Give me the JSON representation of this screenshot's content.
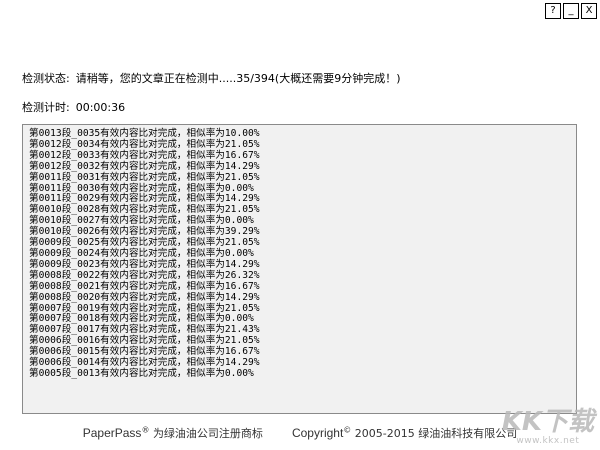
{
  "window": {
    "buttons": [
      {
        "label": "?"
      },
      {
        "label": "_"
      },
      {
        "label": "X"
      }
    ]
  },
  "status": {
    "label": "检测状态:",
    "message": "请稍等，您的文章正在检测中.....35/394(大概还需要9分钟完成！)"
  },
  "timer": {
    "label": "检测计时:",
    "value": "00:00:36"
  },
  "log": {
    "lines": [
      "第0013段_0035有效内容比对完成，相似率为10.00%",
      "第0012段_0034有效内容比对完成，相似率为21.05%",
      "第0012段_0033有效内容比对完成，相似率为16.67%",
      "第0012段_0032有效内容比对完成，相似率为14.29%",
      "第0011段_0031有效内容比对完成，相似率为21.05%",
      "第0011段_0030有效内容比对完成，相似率为0.00%",
      "第0011段_0029有效内容比对完成，相似率为14.29%",
      "第0010段_0028有效内容比对完成，相似率为21.05%",
      "第0010段_0027有效内容比对完成，相似率为0.00%",
      "第0010段_0026有效内容比对完成，相似率为39.29%",
      "第0009段_0025有效内容比对完成，相似率为21.05%",
      "第0009段_0024有效内容比对完成，相似率为0.00%",
      "第0009段_0023有效内容比对完成，相似率为14.29%",
      "第0008段_0022有效内容比对完成，相似率为26.32%",
      "第0008段_0021有效内容比对完成，相似率为16.67%",
      "第0008段_0020有效内容比对完成，相似率为14.29%",
      "第0007段_0019有效内容比对完成，相似率为21.05%",
      "第0007段_0018有效内容比对完成，相似率为0.00%",
      "第0007段_0017有效内容比对完成，相似率为21.43%",
      "第0006段_0016有效内容比对完成，相似率为21.05%",
      "第0006段_0015有效内容比对完成，相似率为16.67%",
      "第0006段_0014有效内容比对完成，相似率为14.29%",
      "第0005段_0013有效内容比对完成，相似率为0.00%"
    ]
  },
  "footer": {
    "brand": "PaperPass",
    "registered": "®",
    "trademark": "为绿油油公司注册商标",
    "copyright": "Copyright",
    "copyright_symbol": "©",
    "copyright_text": "2005-2015 绿油油科技有限公司"
  },
  "watermark": {
    "logo": "KK下载",
    "url": "www.kkx.net"
  }
}
